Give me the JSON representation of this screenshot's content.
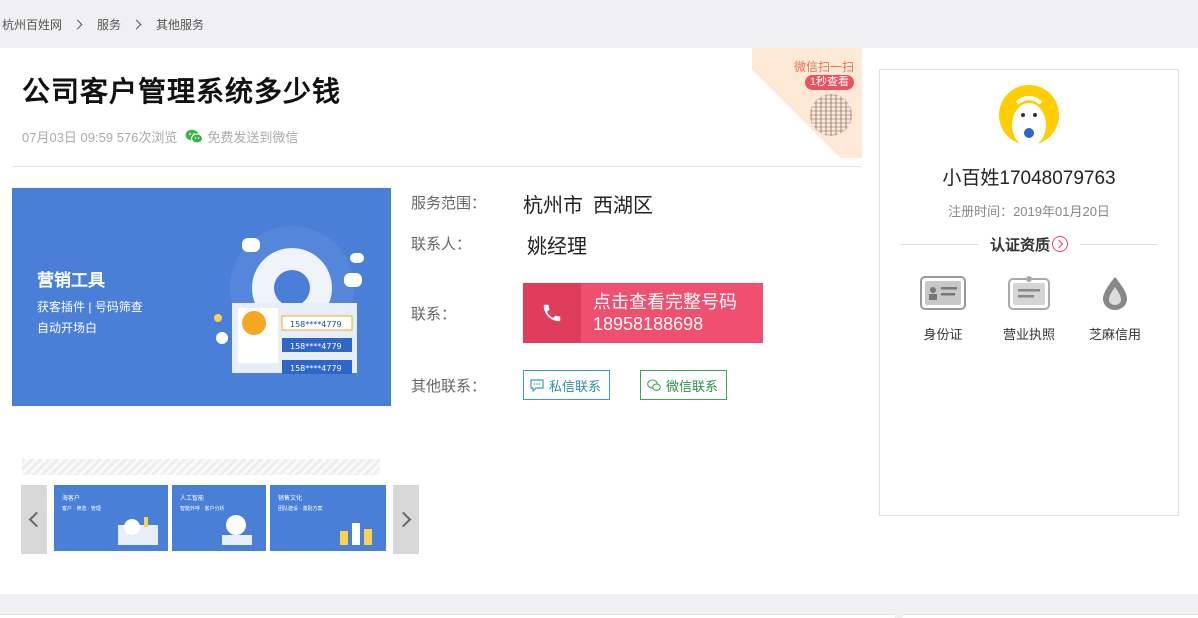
{
  "breadcrumb": {
    "items": [
      "杭州百姓网",
      "服务",
      "其他服务"
    ]
  },
  "post": {
    "title": "公司客户管理系统多少钱",
    "date": "07月03日 09:59",
    "views": "576次浏览",
    "wechat_send": "免费发送到微信",
    "qr_scan": "微信扫一扫",
    "qr_badge": "1秒查看"
  },
  "banner": {
    "heading": "营销工具",
    "line1": "获客插件 | 号码筛查",
    "line2": "自动开场白",
    "phone_tag": "158****4779"
  },
  "details": {
    "scope_label": "服务范围：",
    "scope_city": "杭州市",
    "scope_district": "西湖区",
    "contact_label": "联系人：",
    "contact_value": "姚经理",
    "phone_label": "联系：",
    "phone_btn_line1": "点击查看完整号码",
    "phone_btn_line2": "18958188698",
    "other_label": "其他联系：",
    "private_msg": "私信联系",
    "wechat_msg": "微信联系"
  },
  "thumbs": [
    {
      "title": "海客户",
      "sub": "客户 · 筛选 · 管理"
    },
    {
      "title": "人工智能",
      "sub": "智能外呼 · 客户分析"
    },
    {
      "title": "销售文化",
      "sub": "团队建设 · 激励方案"
    }
  ],
  "profile": {
    "username": "小百姓17048079763",
    "register": "注册时间：2019年01月20日",
    "cert_title": "认证资质",
    "certs": [
      "身份证",
      "营业执照",
      "芝麻信用"
    ]
  },
  "colors": {
    "accent": "#f14f6f",
    "banner": "#4a7fd8",
    "wechat": "#3aaa55",
    "private": "#35a3b5"
  }
}
